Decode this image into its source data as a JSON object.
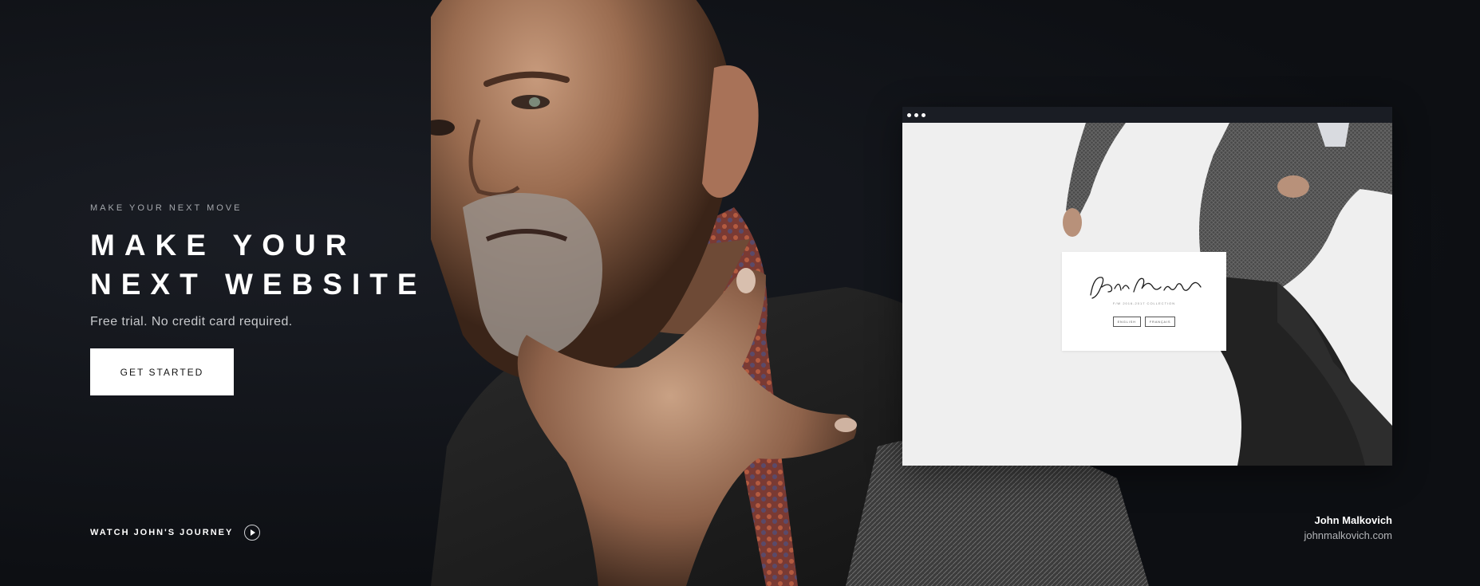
{
  "hero": {
    "eyebrow": "MAKE YOUR NEXT MOVE",
    "headline_line1": "MAKE YOUR",
    "headline_line2": "NEXT WEBSITE",
    "subline": "Free trial. No credit card required.",
    "cta_label": "GET STARTED",
    "journey_label": "WATCH JOHN'S JOURNEY",
    "play_icon": "play-circle-icon"
  },
  "mockup": {
    "signature_text": "John Malkovich",
    "collection_text": "F/W 2016-2017 COLLECTION",
    "languages": [
      "ENGLISH",
      "FRANÇAIS"
    ]
  },
  "caption": {
    "name": "John Malkovich",
    "url": "johnmalkovich.com"
  },
  "colors": {
    "background": "#0f1116",
    "cta_bg": "#ffffff",
    "cta_text": "#111111",
    "mockup_bar": "#1a1d24",
    "mockup_page": "#efefef"
  }
}
